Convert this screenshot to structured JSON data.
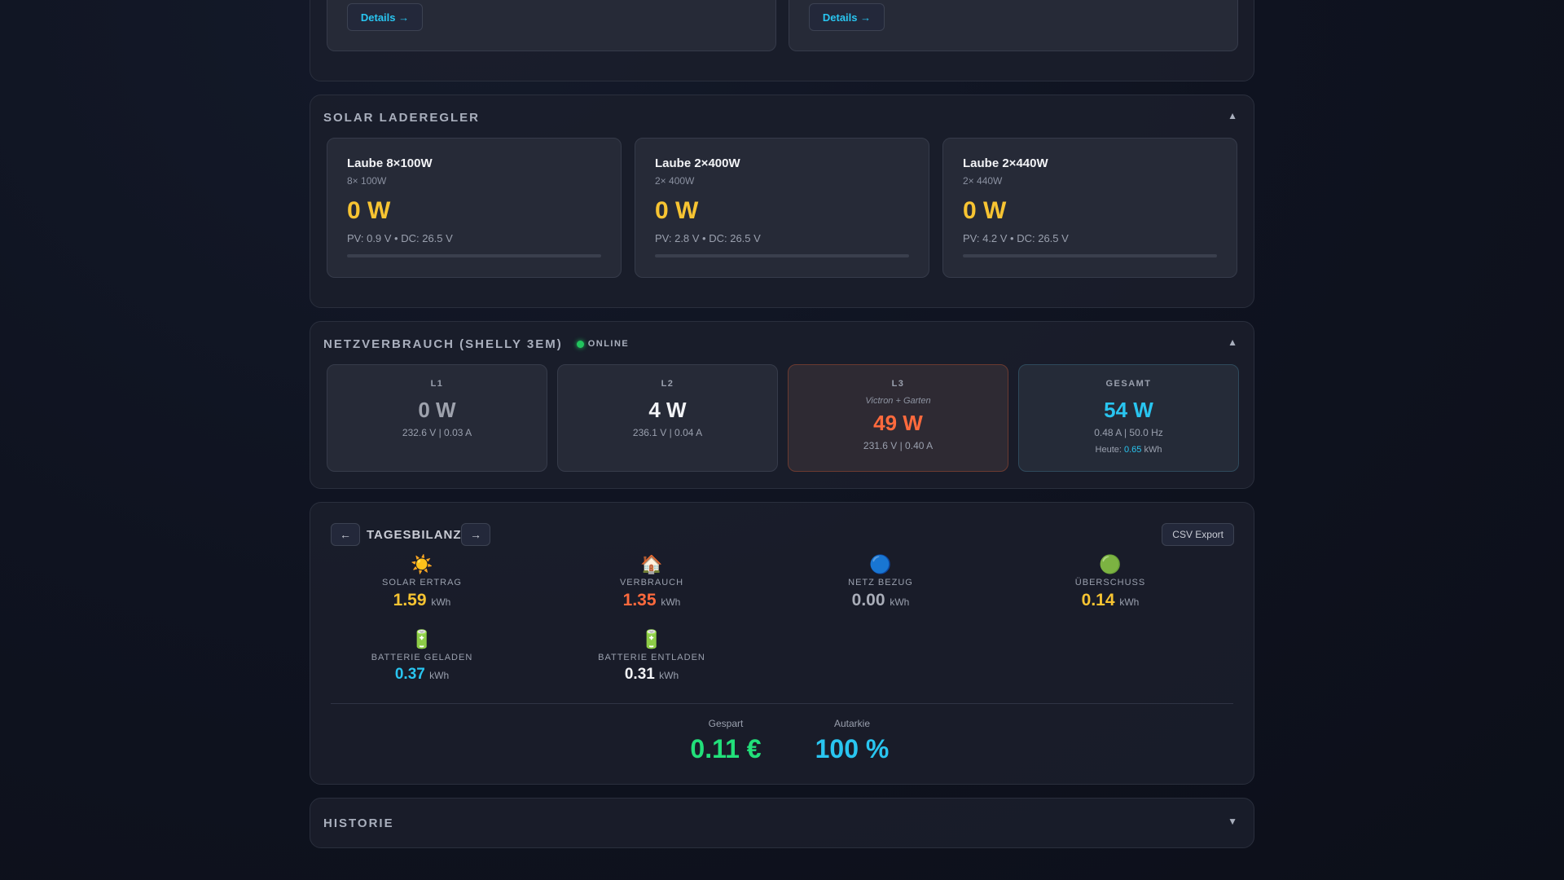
{
  "top_panel": {
    "details_left": "Details →",
    "details_right": "Details →"
  },
  "solar": {
    "title": "SOLAR LADEREGLER",
    "toggle": "▲",
    "chargers": [
      {
        "name": "Laube 8×100W",
        "sub": "8× 100W",
        "power": "0 W",
        "info": "PV: 0.9 V • DC: 26.5 V",
        "load_fraction": 0
      },
      {
        "name": "Laube 2×400W",
        "sub": "2× 400W",
        "power": "0 W",
        "info": "PV: 2.8 V • DC: 26.5 V",
        "load_fraction": 0
      },
      {
        "name": "Laube 2×440W",
        "sub": "2× 440W",
        "power": "0 W",
        "info": "PV: 4.2 V • DC: 26.5 V",
        "load_fraction": 0
      }
    ]
  },
  "grid": {
    "title": "NETZVERBRAUCH (SHELLY 3EM)",
    "status": "ONLINE",
    "toggle": "▲",
    "phases": [
      {
        "label": "L1",
        "value": "0 W",
        "meta": "232.6 V | 0.03 A"
      },
      {
        "label": "L2",
        "value": "4 W",
        "meta": "236.1 V | 0.04 A"
      },
      {
        "label": "L3",
        "note": "Victron + Garten",
        "value": "49 W",
        "meta": "231.6 V | 0.40 A"
      }
    ],
    "total": {
      "label": "GESAMT",
      "value": "54 W",
      "meta": "0.48 A | 50.0 Hz",
      "today_prefix": "Heute:",
      "today_value": "0.65",
      "today_unit": "kWh"
    }
  },
  "daily": {
    "title": "TAGESBILANZ",
    "prev": "←",
    "next": "→",
    "export": "CSV Export",
    "unit": "kWh",
    "stats": [
      {
        "icon": "☀️",
        "label": "SOLAR ERTRAG",
        "value": "1.59"
      },
      {
        "icon": "🏠",
        "label": "VERBRAUCH",
        "value": "1.35"
      },
      {
        "icon": "🔵",
        "label": "NETZ BEZUG",
        "value": "0.00"
      },
      {
        "icon": "🟢",
        "label": "ÜBERSCHUSS",
        "value": "0.14"
      },
      {
        "icon": "🔋",
        "label": "BATTERIE GELADEN",
        "value": "0.37"
      },
      {
        "icon": "🔋",
        "label": "BATTERIE ENTLADEN",
        "value": "0.31"
      }
    ],
    "saved_label": "Gespart",
    "saved_value": "0.11 €",
    "autarky_label": "Autarkie",
    "autarky_value": "100 %"
  },
  "history": {
    "title": "HISTORIE",
    "toggle": "▼"
  },
  "colors": {
    "solar": "#f7c432",
    "consumption": "#ff6a3d",
    "grid": "#a9adb8",
    "battery": "#29c5f0",
    "saved": "#22e07a",
    "online": "#22c55e"
  }
}
